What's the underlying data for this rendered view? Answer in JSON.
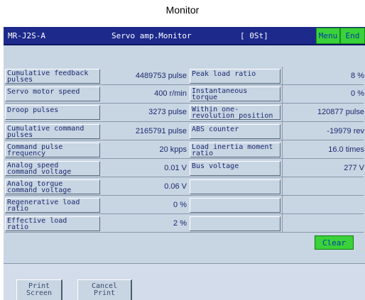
{
  "page_title": "Monitor",
  "titlebar": {
    "model": "MR-J2S-A",
    "screen_name": "Servo amp.Monitor",
    "station": "[ 0St]",
    "menu_label": "Menu",
    "end_label": "End"
  },
  "left_rows": [
    {
      "label": "Cumulative feedback\npulses",
      "value": "4489753 pulse"
    },
    {
      "label": "Servo motor speed",
      "value": "400 r/min"
    },
    {
      "label": "Droop pulses",
      "value": "3273 pulse"
    },
    {
      "label": "Cumulative command\npulses",
      "value": "2165791 pulse"
    },
    {
      "label": "Command pulse\nfrequency",
      "value": "20 kpps"
    },
    {
      "label": "Analog speed\ncommand voltage",
      "value": "0.01 V"
    },
    {
      "label": "Analog torque\ncommand voltage",
      "value": "0.06 V"
    },
    {
      "label": "Regenerative load\nratio",
      "value": "0 %"
    },
    {
      "label": "Effective load\nratio",
      "value": "2 %"
    }
  ],
  "right_rows": [
    {
      "label": "Peak load ratio",
      "value": "8 %"
    },
    {
      "label": "Instantaneous\ntorque",
      "value": "0 %"
    },
    {
      "label": "Within one-\nrevolution position",
      "value": "120877 pulse"
    },
    {
      "label": "ABS counter",
      "value": "-19979 rev"
    },
    {
      "label": "Load inertia moment\nratio",
      "value": "16.0 times"
    },
    {
      "label": "Bus voltage",
      "value": "277 V"
    },
    {
      "label": "",
      "value": ""
    },
    {
      "label": "",
      "value": ""
    },
    {
      "label": "",
      "value": ""
    }
  ],
  "clear_label": "Clear",
  "print_screen_label": "Print\nScreen",
  "cancel_print_label": "Cancel\nPrint",
  "colors": {
    "titlebar_bg": "#1d2a8c",
    "screen_bg": "#c8d5e3",
    "button_green": "#3ad23a",
    "text_blue": "#1c2a6e"
  }
}
